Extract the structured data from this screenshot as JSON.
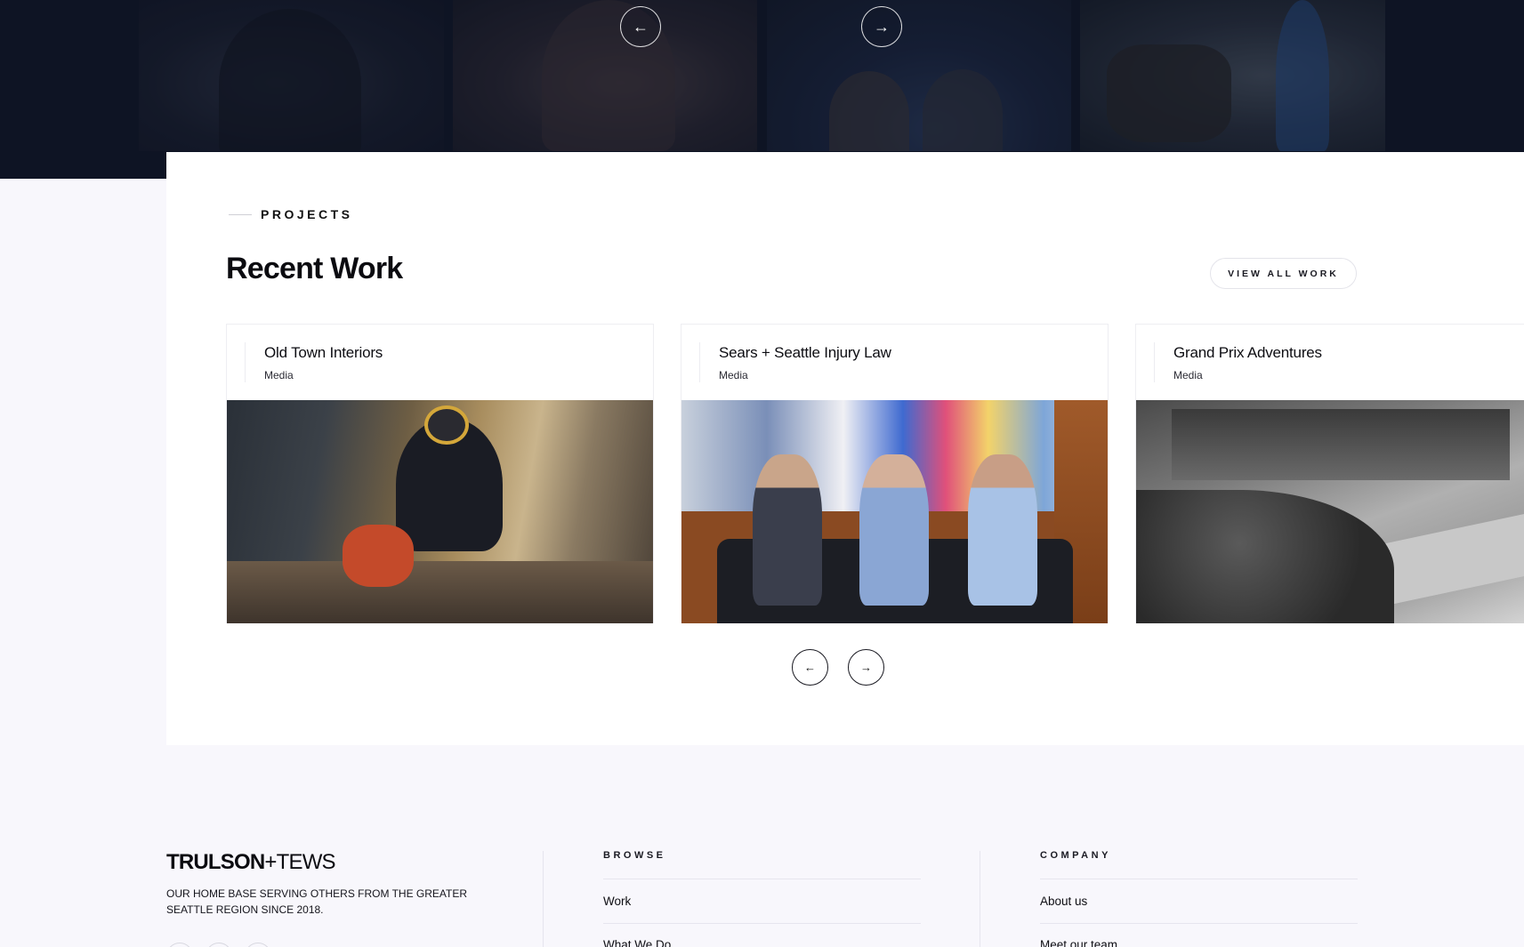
{
  "hero": {
    "prev_icon": "arrow-left-icon",
    "next_icon": "arrow-right-icon",
    "prev_glyph": "←",
    "next_glyph": "→"
  },
  "projects": {
    "eyebrow": "PROJECTS",
    "title": "Recent Work",
    "view_all_label": "VIEW ALL WORK",
    "cards": [
      {
        "name": "Old Town Interiors",
        "category": "Media"
      },
      {
        "name": "Sears + Seattle Injury Law",
        "category": "Media"
      },
      {
        "name": "Grand Prix Adventures",
        "category": "Media"
      }
    ],
    "prev_glyph": "←",
    "next_glyph": "→"
  },
  "footer": {
    "logo_bold": "TRULSON",
    "logo_rest": "+TEWS",
    "tagline": "OUR HOME BASE SERVING OTHERS FROM THE GREATER SEATTLE REGION SINCE 2018.",
    "browse": {
      "title": "BROWSE",
      "links": [
        "Work",
        "What We Do"
      ]
    },
    "company": {
      "title": "COMPANY",
      "links": [
        "About us",
        "Meet our team"
      ]
    }
  }
}
